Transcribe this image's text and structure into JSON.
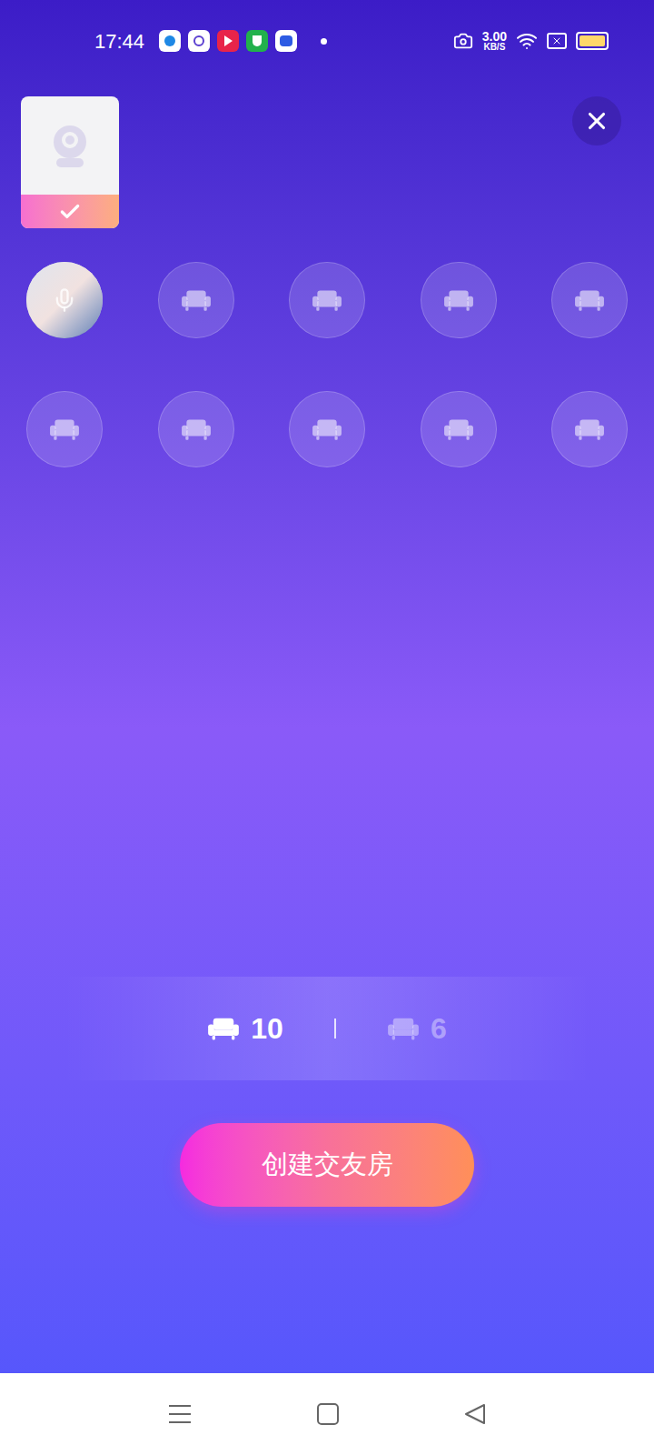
{
  "status_bar": {
    "time": "17:44",
    "network_speed": "3.00",
    "network_unit": "KB/S"
  },
  "cover": {
    "selected": true
  },
  "seats": [
    {
      "kind": "host"
    },
    {
      "kind": "empty"
    },
    {
      "kind": "empty"
    },
    {
      "kind": "empty"
    },
    {
      "kind": "empty"
    },
    {
      "kind": "empty"
    },
    {
      "kind": "empty"
    },
    {
      "kind": "empty"
    },
    {
      "kind": "empty"
    },
    {
      "kind": "empty"
    }
  ],
  "seat_options": [
    {
      "label": "10",
      "selected": true
    },
    {
      "label": "6",
      "selected": false
    }
  ],
  "create_button": "创建交友房"
}
